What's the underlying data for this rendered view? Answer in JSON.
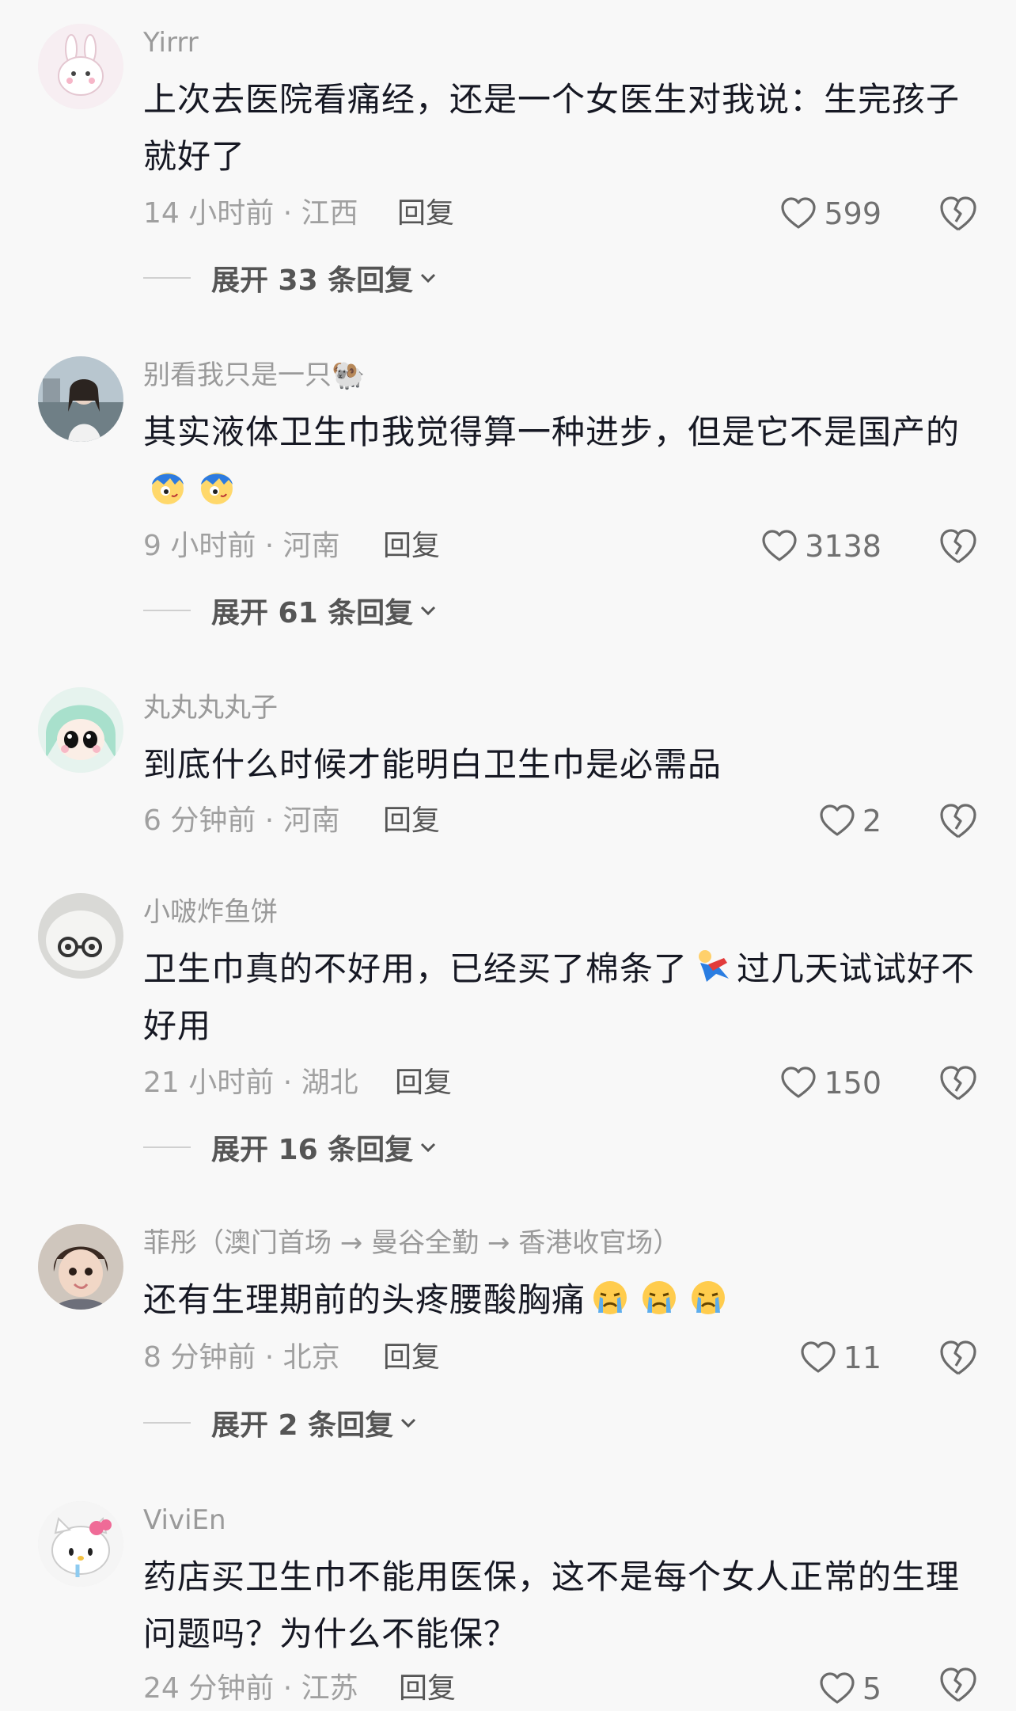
{
  "reply_label": "回复",
  "comments": [
    {
      "username": "Yirrr",
      "text": "上次去医院看痛经，还是一个女医生对我说：生完孩子就好了",
      "meta": "14 小时前 · 江西",
      "likes": "599",
      "expand": "展开 33 条回复"
    },
    {
      "username": "别看我只是一只",
      "username_emoji": "🐏",
      "text": "其实液体卫生巾我觉得算一种进步，但是它不是国产的",
      "meta": "9 小时前 · 河南",
      "likes": "3138",
      "expand": "展开 61 条回复"
    },
    {
      "username": "丸丸丸丸子",
      "text": "到底什么时候才能明白卫生巾是必需品",
      "meta": "6 分钟前 · 河南",
      "likes": "2"
    },
    {
      "username": "小啵炸鱼饼",
      "text_a": "卫生巾真的不好用，已经买了棉条了",
      "text_b": "过几天试试好不好用",
      "meta": "21 小时前 · 湖北",
      "likes": "150",
      "expand": "展开 16 条回复"
    },
    {
      "username": "菲彤（澳门首场 → 曼谷全勤 → 香港收官场）",
      "text": "还有生理期前的头疼腰酸胸痛",
      "meta": "8 分钟前 · 北京",
      "likes": "11",
      "expand": "展开 2 条回复"
    },
    {
      "username": "ViviEn",
      "text": "药店买卫生巾不能用医保，这不是每个女人正常的生理问题吗？为什么不能保？",
      "meta": "24 分钟前 · 江苏",
      "likes": "5"
    }
  ]
}
